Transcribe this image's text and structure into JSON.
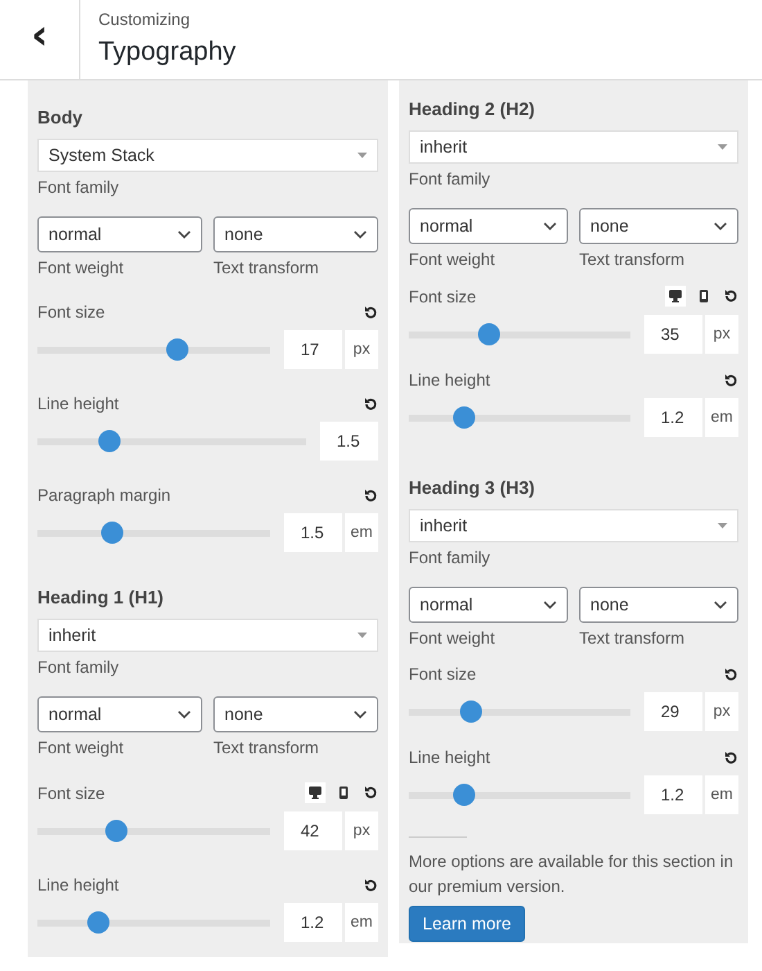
{
  "header": {
    "back": "‹",
    "subtitle": "Customizing",
    "title": "Typography"
  },
  "columns": [
    {
      "sections": [
        {
          "heading": "Body",
          "family": {
            "value": "System Stack",
            "label": "Font family"
          },
          "weight": {
            "value": "normal",
            "label": "Font weight"
          },
          "transform": {
            "value": "none",
            "label": "Text transform"
          },
          "controls": [
            {
              "label": "Font size",
              "level": 0.6,
              "value": "17",
              "unit": "px"
            },
            {
              "label": "Line height",
              "level": 0.27,
              "value": "1.5"
            },
            {
              "label": "Paragraph margin",
              "level": 0.32,
              "value": "1.5",
              "unit": "em"
            }
          ]
        },
        {
          "heading": "Heading 1 (H1)",
          "family": {
            "value": "inherit",
            "label": "Font family"
          },
          "weight": {
            "value": "normal",
            "label": "Font weight"
          },
          "transform": {
            "value": "none",
            "label": "Text transform"
          },
          "controls": [
            {
              "label": "Font size",
              "devices": [
                {
                  "kind": "desktop",
                  "selected": true
                },
                {
                  "kind": "mobile",
                  "selected": false
                }
              ],
              "level": 0.34,
              "value": "42",
              "unit": "px"
            },
            {
              "label": "Line height",
              "level": 0.26,
              "value": "1.2",
              "unit": "em"
            }
          ]
        }
      ]
    },
    {
      "sections": [
        {
          "heading": "Heading 2 (H2)",
          "family": {
            "value": "inherit",
            "label": "Font family"
          },
          "weight": {
            "value": "normal",
            "label": "Font weight"
          },
          "transform": {
            "value": "none",
            "label": "Text transform"
          },
          "controls": [
            {
              "label": "Font size",
              "devices": [
                {
                  "kind": "desktop",
                  "selected": true
                },
                {
                  "kind": "mobile",
                  "selected": false
                }
              ],
              "level": 0.36,
              "value": "35",
              "unit": "px"
            },
            {
              "label": "Line height",
              "level": 0.25,
              "value": "1.2",
              "unit": "em"
            }
          ]
        },
        {
          "heading": "Heading 3 (H3)",
          "family": {
            "value": "inherit",
            "label": "Font family"
          },
          "weight": {
            "value": "normal",
            "label": "Font weight"
          },
          "transform": {
            "value": "none",
            "label": "Text transform"
          },
          "controls": [
            {
              "label": "Font size",
              "level": 0.28,
              "value": "29",
              "unit": "px"
            },
            {
              "label": "Line height",
              "level": 0.25,
              "value": "1.2",
              "unit": "em"
            }
          ]
        }
      ],
      "notice": {
        "text": "More options are available for this section in our premium version.",
        "button": "Learn more"
      }
    }
  ]
}
